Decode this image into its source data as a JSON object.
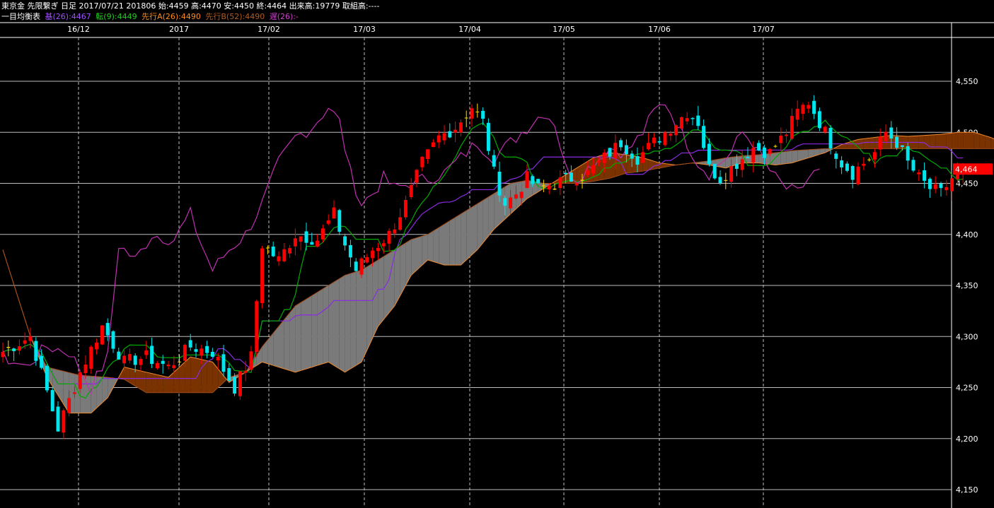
{
  "header": {
    "line1": "東京金 先限繋ぎ 日足 2017/07/21 201806 始:4459 高:4470 安:4450 終:4464 出来高:19779 取組高:----",
    "indicator_name": "一目均衡表",
    "kijun": "基(26):4467",
    "tenkan": "転(9):4449",
    "senkou_a": "先行A(26):4490",
    "senkou_b": "先行B(52):4490",
    "chikou": "遅(26):-"
  },
  "colors": {
    "background": "#000000",
    "grid": "#ffffff",
    "up_candle": "#ff0000",
    "down_candle": "#00e5ee",
    "doji": "#ffd700",
    "tenkan": "#00aa00",
    "kijun": "#8a2be2",
    "chikou": "#c030b0",
    "cloud_bull": "#7a3300",
    "cloud_bull_edge": "#f08a30",
    "cloud_bear": "#7a7a7a",
    "price_tag": "#ff0000"
  },
  "chart_data": {
    "type": "candlestick",
    "title": "東京金 先限繋ぎ 日足",
    "x_labels": [
      "16/12",
      "2017",
      "17/02",
      "17/03",
      "17/04",
      "17/05",
      "17/06",
      "17/07"
    ],
    "y_ticks": [
      4150,
      4200,
      4250,
      4300,
      4350,
      4400,
      4450,
      4500,
      4550
    ],
    "y_tick_labels": [
      "4,150",
      "4,200",
      "4,250",
      "4,300",
      "4,350",
      "4,400",
      "4,450",
      "4,500",
      "4,550"
    ],
    "ylim": [
      4140,
      4585
    ],
    "last_price": 4464,
    "last_price_label": "4,464",
    "grid": true,
    "last_bar": {
      "date": "2017/07/21",
      "open": 4459,
      "high": 4470,
      "low": 4450,
      "close": 4464,
      "volume": 19779
    },
    "indicator_values": {
      "kijun": 4467,
      "tenkan": 4449,
      "senkou_a": 4490,
      "senkou_b": 4490
    },
    "price_anchors": [
      [
        0,
        4285
      ],
      [
        5,
        4300
      ],
      [
        10,
        4210
      ],
      [
        14,
        4265
      ],
      [
        18,
        4310
      ],
      [
        22,
        4275
      ],
      [
        26,
        4280
      ],
      [
        30,
        4270
      ],
      [
        34,
        4290
      ],
      [
        38,
        4285
      ],
      [
        42,
        4250
      ],
      [
        45,
        4280
      ],
      [
        47,
        4390
      ],
      [
        50,
        4375
      ],
      [
        53,
        4400
      ],
      [
        57,
        4395
      ],
      [
        60,
        4420
      ],
      [
        62,
        4390
      ],
      [
        64,
        4365
      ],
      [
        67,
        4385
      ],
      [
        70,
        4400
      ],
      [
        73,
        4430
      ],
      [
        76,
        4470
      ],
      [
        79,
        4495
      ],
      [
        82,
        4505
      ],
      [
        85,
        4525
      ],
      [
        87,
        4510
      ],
      [
        89,
        4460
      ],
      [
        91,
        4430
      ],
      [
        93,
        4440
      ],
      [
        95,
        4455
      ],
      [
        97,
        4445
      ],
      [
        100,
        4450
      ],
      [
        103,
        4455
      ],
      [
        106,
        4460
      ],
      [
        109,
        4475
      ],
      [
        112,
        4490
      ],
      [
        115,
        4475
      ],
      [
        118,
        4490
      ],
      [
        121,
        4505
      ],
      [
        124,
        4520
      ],
      [
        126,
        4510
      ],
      [
        128,
        4465
      ],
      [
        130,
        4455
      ],
      [
        133,
        4470
      ],
      [
        136,
        4485
      ],
      [
        139,
        4480
      ],
      [
        142,
        4500
      ],
      [
        144,
        4520
      ],
      [
        146,
        4530
      ],
      [
        148,
        4510
      ],
      [
        150,
        4490
      ],
      [
        152,
        4470
      ],
      [
        154,
        4460
      ],
      [
        156,
        4470
      ],
      [
        158,
        4480
      ],
      [
        160,
        4500
      ],
      [
        162,
        4490
      ],
      [
        164,
        4470
      ],
      [
        166,
        4455
      ],
      [
        168,
        4445
      ],
      [
        170,
        4440
      ],
      [
        172,
        4455
      ],
      [
        174,
        4464
      ]
    ],
    "cloud_a_anchors": [
      [
        0,
        4385
      ],
      [
        5,
        4300
      ],
      [
        8,
        4260
      ],
      [
        12,
        4225
      ],
      [
        16,
        4225
      ],
      [
        19,
        4240
      ],
      [
        22,
        4270
      ],
      [
        26,
        4265
      ],
      [
        30,
        4260
      ],
      [
        34,
        4280
      ],
      [
        38,
        4275
      ],
      [
        41,
        4255
      ],
      [
        44,
        4265
      ],
      [
        47,
        4275
      ],
      [
        50,
        4270
      ],
      [
        53,
        4265
      ],
      [
        56,
        4270
      ],
      [
        59,
        4275
      ],
      [
        62,
        4265
      ],
      [
        65,
        4275
      ],
      [
        68,
        4310
      ],
      [
        71,
        4330
      ],
      [
        74,
        4360
      ],
      [
        77,
        4375
      ],
      [
        80,
        4370
      ],
      [
        83,
        4370
      ],
      [
        86,
        4385
      ],
      [
        89,
        4405
      ],
      [
        92,
        4420
      ],
      [
        95,
        4435
      ],
      [
        98,
        4445
      ],
      [
        101,
        4455
      ],
      [
        104,
        4465
      ],
      [
        107,
        4475
      ],
      [
        110,
        4480
      ],
      [
        113,
        4478
      ],
      [
        116,
        4475
      ],
      [
        119,
        4470
      ],
      [
        122,
        4468
      ],
      [
        125,
        4470
      ],
      [
        128,
        4468
      ],
      [
        131,
        4465
      ],
      [
        134,
        4470
      ],
      [
        137,
        4470
      ],
      [
        140,
        4468
      ],
      [
        143,
        4470
      ],
      [
        146,
        4475
      ],
      [
        149,
        4480
      ],
      [
        152,
        4488
      ],
      [
        155,
        4493
      ],
      [
        158,
        4495
      ],
      [
        161,
        4497
      ],
      [
        164,
        4496
      ],
      [
        167,
        4497
      ],
      [
        170,
        4498
      ],
      [
        173,
        4500
      ],
      [
        176,
        4500
      ],
      [
        179,
        4495
      ],
      [
        182,
        4488
      ],
      [
        185,
        4482
      ],
      [
        188,
        4482
      ],
      [
        191,
        4478
      ],
      [
        194,
        4476
      ],
      [
        197,
        4474
      ],
      [
        200,
        4470
      ]
    ],
    "cloud_b_anchors": [
      [
        0,
        4385
      ],
      [
        5,
        4300
      ],
      [
        8,
        4270
      ],
      [
        14,
        4262
      ],
      [
        19,
        4260
      ],
      [
        22,
        4258
      ],
      [
        26,
        4245
      ],
      [
        32,
        4245
      ],
      [
        38,
        4245
      ],
      [
        41,
        4260
      ],
      [
        44,
        4265
      ],
      [
        47,
        4290
      ],
      [
        50,
        4310
      ],
      [
        53,
        4330
      ],
      [
        56,
        4340
      ],
      [
        59,
        4350
      ],
      [
        62,
        4360
      ],
      [
        65,
        4365
      ],
      [
        68,
        4375
      ],
      [
        71,
        4385
      ],
      [
        74,
        4395
      ],
      [
        77,
        4400
      ],
      [
        80,
        4410
      ],
      [
        83,
        4420
      ],
      [
        86,
        4430
      ],
      [
        89,
        4440
      ],
      [
        92,
        4450
      ],
      [
        95,
        4453
      ],
      [
        98,
        4450
      ],
      [
        101,
        4450
      ],
      [
        104,
        4450
      ],
      [
        107,
        4452
      ],
      [
        110,
        4455
      ],
      [
        113,
        4460
      ],
      [
        116,
        4462
      ],
      [
        119,
        4465
      ],
      [
        122,
        4468
      ],
      [
        125,
        4470
      ],
      [
        128,
        4472
      ],
      [
        131,
        4475
      ],
      [
        134,
        4477
      ],
      [
        137,
        4478
      ],
      [
        140,
        4480
      ],
      [
        143,
        4482
      ],
      [
        146,
        4483
      ],
      [
        149,
        4484
      ],
      [
        152,
        4484
      ],
      [
        155,
        4484
      ],
      [
        158,
        4484
      ],
      [
        161,
        4484
      ],
      [
        164,
        4484
      ],
      [
        167,
        4484
      ],
      [
        170,
        4484
      ],
      [
        173,
        4484
      ],
      [
        176,
        4484
      ],
      [
        179,
        4484
      ],
      [
        182,
        4484
      ],
      [
        185,
        4484
      ],
      [
        188,
        4484
      ],
      [
        191,
        4484
      ],
      [
        194,
        4484
      ],
      [
        197,
        4484
      ],
      [
        200,
        4484
      ]
    ]
  }
}
